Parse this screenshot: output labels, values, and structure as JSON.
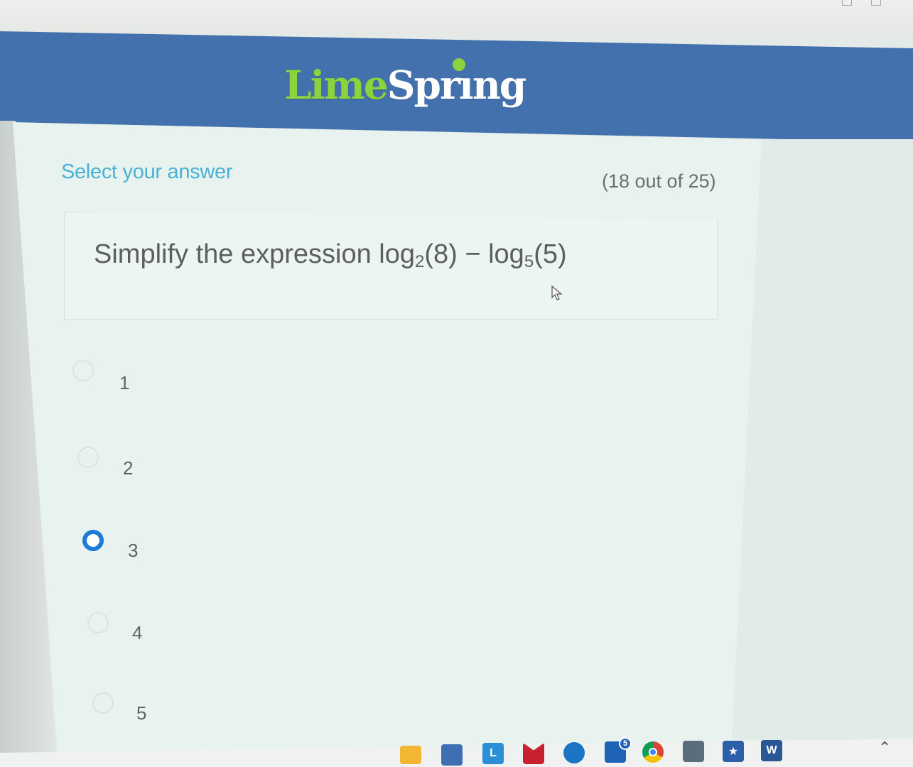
{
  "header": {
    "logo_part1": "Lime",
    "logo_part2": "Sprıng"
  },
  "quiz": {
    "heading": "Select your answer",
    "progress": "(18 out of 25)",
    "question_prefix": "Simplify the expression log",
    "question_sub1": "2",
    "question_mid": "(8) − log",
    "question_sub2": "5",
    "question_suffix": "(5)",
    "options": [
      {
        "label": "1",
        "selected": false
      },
      {
        "label": "2",
        "selected": false
      },
      {
        "label": "3",
        "selected": true
      },
      {
        "label": "4",
        "selected": false
      },
      {
        "label": "5",
        "selected": false
      }
    ]
  },
  "taskbar": {
    "icons": [
      "file-explorer-icon",
      "store-icon",
      "l-app-icon",
      "mcafee-icon",
      "blue-app-icon",
      "outlook-icon",
      "chrome-icon",
      "calculator-icon",
      "star-app-icon",
      "word-icon"
    ],
    "outlook_badge": "5",
    "l_app_label": "L",
    "word_label": "W"
  },
  "colors": {
    "header_blue": "#4371ae",
    "lime": "#8cd43c",
    "heading_cyan": "#4ab0d6",
    "radio_selected": "#1d7ad8"
  }
}
